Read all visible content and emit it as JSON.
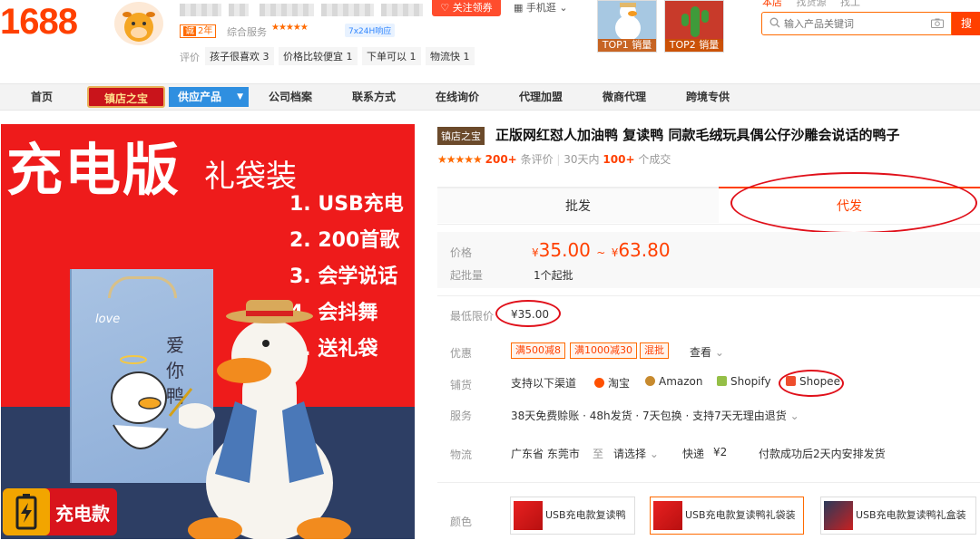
{
  "header": {
    "logo": "1688",
    "years_badge_k": "诚",
    "years_badge": "2年",
    "service_label": "综合服务",
    "service_stars": "★★★★★",
    "response_badge": "7x24H响应",
    "eval_label": "评价",
    "eval_tags": [
      "孩子很喜欢 3",
      "价格比较便宜 1",
      "下单可以 1",
      "物流快 1"
    ],
    "follow_button": "关注领券",
    "mobile_link": "手机逛",
    "top_products": [
      {
        "rank": "TOP1 销量"
      },
      {
        "rank": "TOP2 销量"
      }
    ],
    "search_scopes": [
      "本店",
      "找货源",
      "找工"
    ],
    "search_placeholder": "输入产品关键词",
    "search_button": "搜"
  },
  "nav": {
    "home": "首页",
    "special": "镇店之宝",
    "supply": "供应产品",
    "items": [
      "公司档案",
      "联系方式",
      "在线询价",
      "代理加盟",
      "微商代理",
      "跨境专供"
    ]
  },
  "product_image": {
    "title": "充电版",
    "subtitle": "礼袋装",
    "features": [
      "1. USB充电",
      "2. 200首歌",
      "3. 会学说话",
      "4. 会抖舞",
      "5. 送礼袋"
    ],
    "badge": "充电款",
    "bag_text_1": "love",
    "bag_text_2": "爱你鸭"
  },
  "product": {
    "title_tag": "镇店之宝",
    "title": "正版网红怼人加油鸭 复读鸭 同款毛绒玩具偶公仔沙雕会说话的鸭子",
    "stars": "★★★★★",
    "review_count": "200+",
    "review_label": "条评价",
    "sales_prefix": "30天内",
    "sales_count": "100+",
    "sales_label": "个成交",
    "tabs": {
      "wholesale": "批发",
      "dropship": "代发"
    },
    "price_label": "价格",
    "price_currency": "¥",
    "price_min": "35.00",
    "price_sep": "~",
    "price_max": "63.80",
    "moq_label": "起批量",
    "moq_value": "1个起批",
    "min_price_label": "最低限价",
    "min_price_value": "¥35.00",
    "discount_label": "优惠",
    "coupons": [
      "满500减8",
      "满1000减30",
      "混批"
    ],
    "coupon_more": "查看",
    "channel_label": "铺货",
    "channel_intro": "支持以下渠道",
    "channels": [
      {
        "name": "淘宝",
        "color": "#ff5000"
      },
      {
        "name": "Amazon",
        "color": "#c78a2e"
      },
      {
        "name": "Shopify",
        "color": "#95bf47"
      },
      {
        "name": "Shopee",
        "color": "#ee4d2d"
      }
    ],
    "service_label": "服务",
    "service_items": "38天免费赊账 · 48h发货 · 7天包换 · 支持7天无理由退货",
    "logistics_label": "物流",
    "logistics_from": "广东省 东莞市",
    "logistics_to_label": "至",
    "logistics_to": "请选择",
    "logistics_express": "快递",
    "logistics_fee": "¥2",
    "logistics_note": "付款成功后2天内安排发货",
    "color_label": "颜色",
    "colors": [
      "USB充电款复读鸭",
      "USB充电款复读鸭礼袋装",
      "USB充电款复读鸭礼盒装"
    ],
    "selected_color_index": 1
  },
  "colors": {
    "brand": "#ff4000",
    "annotation": "#e0101a",
    "supply_nav": "#2f8fe0"
  }
}
